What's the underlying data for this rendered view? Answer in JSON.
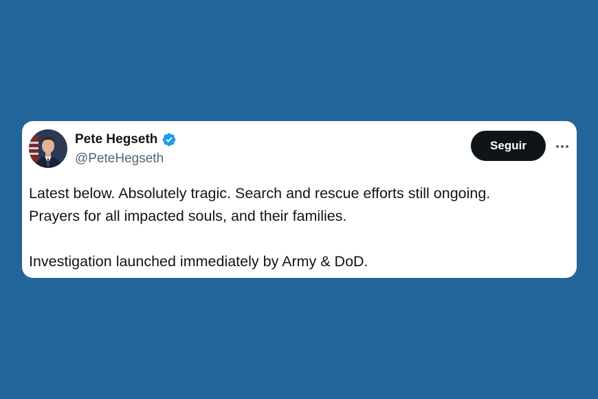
{
  "author": {
    "display_name": "Pete Hegseth",
    "handle": "@PeteHegseth",
    "verified_icon": "verified-badge-icon",
    "verified_color": "#1d9bf0",
    "avatar": "avatar"
  },
  "actions": {
    "follow_label": "Seguir",
    "more_icon": "more-options-icon"
  },
  "tweet": {
    "lines": [
      "Latest below. Absolutely tragic. Search and rescue efforts still ongoing.",
      "Prayers for all impacted souls, and their families.",
      "Investigation launched immediately by Army & DoD."
    ]
  },
  "colors": {
    "background": "#22659a",
    "card": "#ffffff",
    "text_primary": "#0f1419",
    "text_secondary": "#536471",
    "button_bg": "#0f1419"
  }
}
